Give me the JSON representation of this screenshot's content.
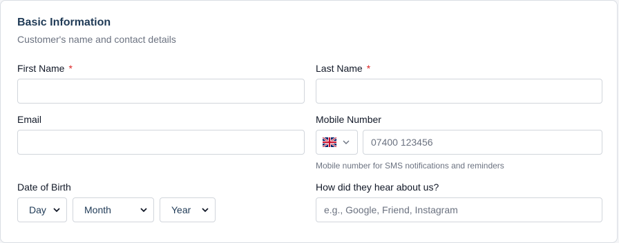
{
  "section": {
    "title": "Basic Information",
    "subtitle": "Customer's name and contact details"
  },
  "fields": {
    "first_name": {
      "label": "First Name",
      "required_mark": "*",
      "value": ""
    },
    "last_name": {
      "label": "Last Name",
      "required_mark": "*",
      "value": ""
    },
    "email": {
      "label": "Email",
      "value": ""
    },
    "mobile": {
      "label": "Mobile Number",
      "placeholder": "07400 123456",
      "hint": "Mobile number for SMS notifications and reminders",
      "country_icon": "uk-flag-icon"
    },
    "dob": {
      "label": "Date of Birth",
      "day": "Day",
      "month": "Month",
      "year": "Year"
    },
    "referral": {
      "label": "How did they hear about us?",
      "placeholder": "e.g., Google, Friend, Instagram"
    }
  },
  "colors": {
    "title": "#1f3a56",
    "required": "#dc2626",
    "border": "#d1d5db"
  }
}
